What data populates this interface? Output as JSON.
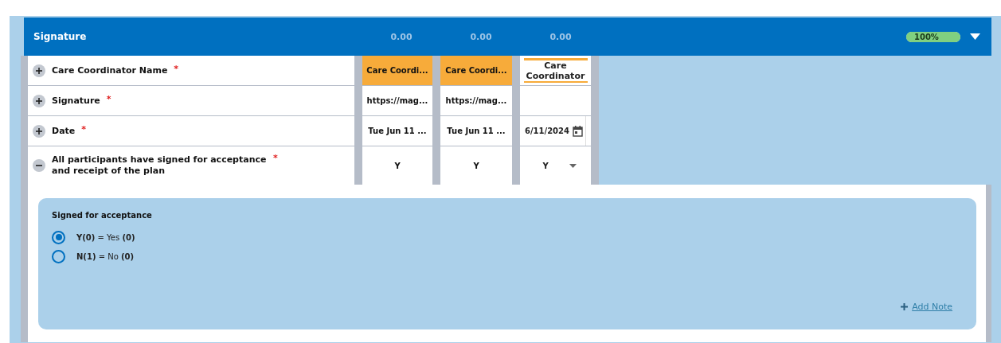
{
  "section": {
    "title": "Signature",
    "totals": [
      "0.00",
      "0.00",
      "0.00"
    ],
    "progress": {
      "label": "100%",
      "level": 1
    },
    "expanded": true
  },
  "rows": [
    {
      "label": "Care Coordinator Name",
      "required_mark": "*",
      "expanded": false,
      "cells": [
        {
          "kind": "highlight",
          "text": "Care Coordi..."
        },
        {
          "kind": "highlight",
          "text": "Care Coordi..."
        },
        {
          "kind": "textarea",
          "text": "Care Coordinator"
        }
      ]
    },
    {
      "label": "Signature",
      "required_mark": "*",
      "expanded": false,
      "cells": [
        {
          "kind": "text",
          "text": "https://mag..."
        },
        {
          "kind": "text",
          "text": "https://mag..."
        },
        {
          "kind": "empty"
        }
      ]
    },
    {
      "label": "Date",
      "required_mark": "*",
      "expanded": false,
      "cells": [
        {
          "kind": "text",
          "text": "Tue Jun 11 ..."
        },
        {
          "kind": "text",
          "text": "Tue Jun 11 ..."
        },
        {
          "kind": "date",
          "text": "6/11/2024"
        }
      ]
    },
    {
      "label": "All participants have signed for acceptance and receipt of the plan",
      "required_mark": "*",
      "expanded": true,
      "cells": [
        {
          "kind": "text",
          "text": "Y"
        },
        {
          "kind": "text",
          "text": "Y"
        },
        {
          "kind": "select",
          "text": "Y"
        }
      ]
    }
  ],
  "detail": {
    "question": "Signed for acceptance",
    "options": [
      {
        "text": "**Y(0)** = Yes **(0)**",
        "selected": true
      },
      {
        "text": "**N(1)** = No **(0)**",
        "selected": false
      }
    ],
    "add_note": "Add Note"
  }
}
